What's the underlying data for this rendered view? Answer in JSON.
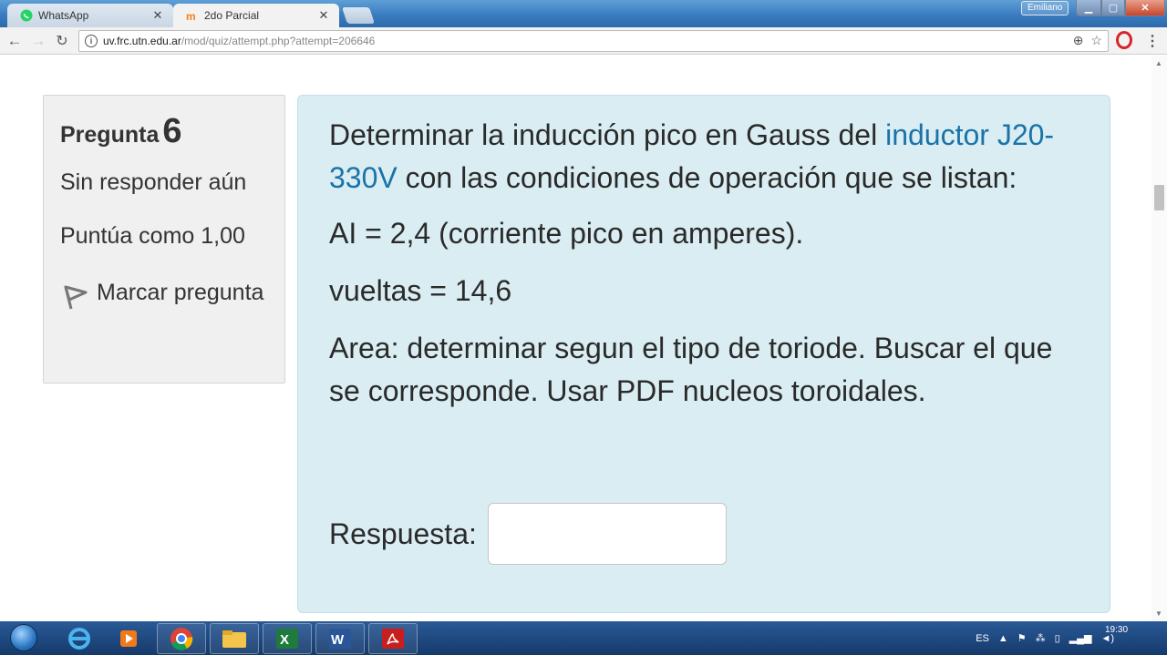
{
  "browser": {
    "tabs": [
      {
        "label": "WhatsApp",
        "icon": "whatsapp-icon"
      },
      {
        "label": "2do Parcial",
        "icon": "moodle-icon"
      }
    ],
    "profile_name": "Emiliano",
    "url_host": "uv.frc.utn.edu.ar",
    "url_path": "/mod/quiz/attempt.php?attempt=206646"
  },
  "question_info": {
    "label": "Pregunta",
    "number": "6",
    "state": "Sin responder aún",
    "grade": "Puntúa como 1,00",
    "flag_label": "Marcar pregunta"
  },
  "question": {
    "intro_before_link": "Determinar la inducción pico en Gauss del ",
    "link_text": "inductor J20-330V",
    "intro_after_link": " con las condiciones de operación que se listan:",
    "line_current": "AI = 2,4 (corriente pico en amperes).",
    "line_turns": "vueltas = 14,6",
    "line_area": "Area: determinar segun el tipo de toriode. Buscar el que se corresponde. Usar PDF nucleos toroidales.",
    "answer_label": "Respuesta:",
    "answer_value": ""
  },
  "taskbar": {
    "language": "ES",
    "time": "19:30"
  },
  "colors": {
    "link": "#1a73a8",
    "formulation_bg": "#d9edf2",
    "info_bg": "#f0f0f0"
  }
}
